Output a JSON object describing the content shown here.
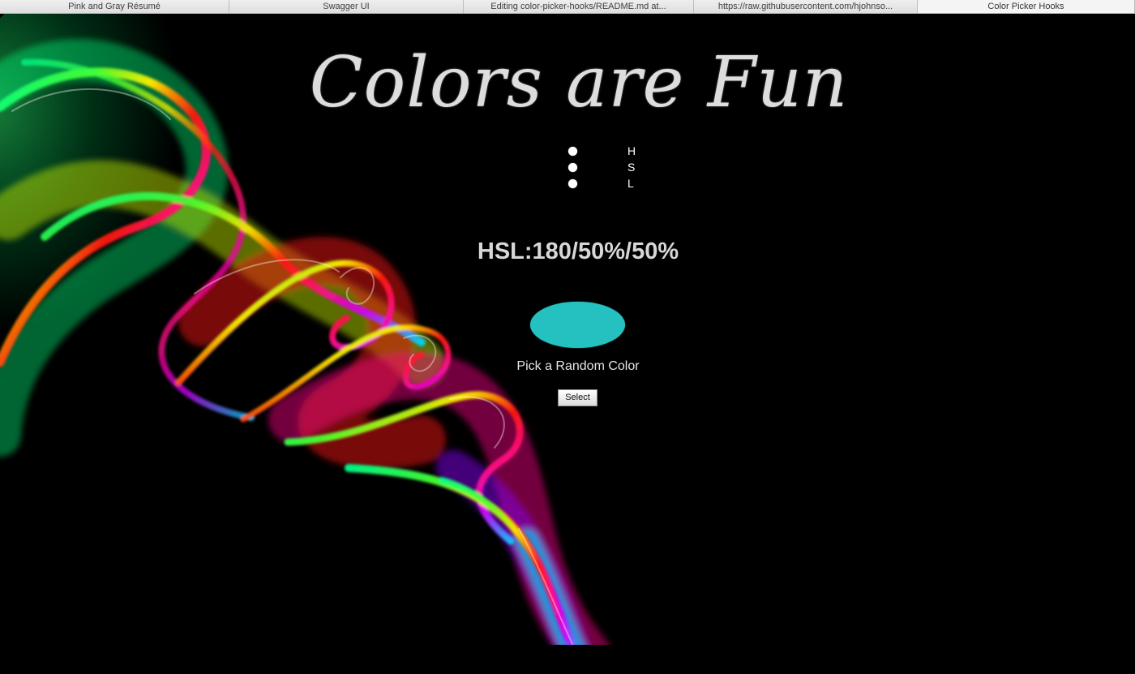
{
  "browser": {
    "tabs": [
      {
        "label": "Pink and Gray Résumé"
      },
      {
        "label": "Swagger UI"
      },
      {
        "label": "Editing color-picker-hooks/README.md at..."
      },
      {
        "label": "https://raw.githubusercontent.com/hjohnso..."
      },
      {
        "label": "Color Picker Hooks",
        "active": true
      }
    ]
  },
  "page": {
    "title": "Colors are Fun",
    "hsl_controls": [
      {
        "letter": "H"
      },
      {
        "letter": "S"
      },
      {
        "letter": "L"
      }
    ],
    "readout": "HSL:180/50%/50%",
    "swatch_color": "#25c0c0",
    "random_label": "Pick a Random Color",
    "select_label": "Select"
  },
  "colors": {
    "background": "#000000",
    "title": "#dddddd",
    "text": "#ffffff",
    "swatch": "#25c0c0"
  },
  "icons": {
    "hsl_dot": "slider-handle-dot-icon"
  }
}
